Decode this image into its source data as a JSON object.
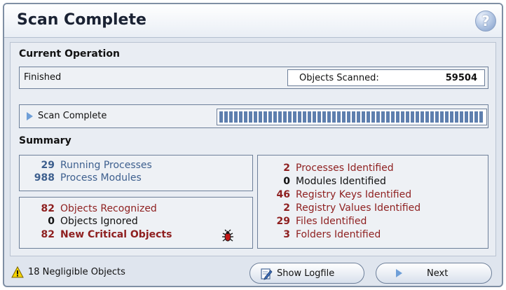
{
  "window": {
    "title": "Scan Complete",
    "help_label": "?"
  },
  "current_operation": {
    "heading": "Current Operation",
    "status": "Finished",
    "objects_scanned_label": "Objects Scanned:",
    "objects_scanned_value": "59504",
    "progress_label": "Scan Complete",
    "progress_fraction": 1.0
  },
  "summary": {
    "heading": "Summary",
    "processes": [
      {
        "count": "29",
        "label": "Running Processes"
      },
      {
        "count": "988",
        "label": "Process Modules"
      }
    ],
    "objects": [
      {
        "count": "82",
        "label": "Objects Recognized"
      },
      {
        "count": "0",
        "label": "Objects Ignored"
      },
      {
        "count": "82",
        "label": "New Critical Objects"
      }
    ],
    "identified": [
      {
        "count": "2",
        "label": "Processes Identified"
      },
      {
        "count": "0",
        "label": "Modules Identified"
      },
      {
        "count": "46",
        "label": "Registry Keys Identified"
      },
      {
        "count": "2",
        "label": "Registry Values Identified"
      },
      {
        "count": "29",
        "label": "Files Identified"
      },
      {
        "count": "3",
        "label": "Folders Identified"
      }
    ],
    "critical_icon": "bug-icon"
  },
  "footer": {
    "negligible_text": "18 Negligible Objects",
    "warning_icon": "warning-icon",
    "show_logfile_label": "Show Logfile",
    "next_label": "Next"
  },
  "colors": {
    "accent_blue": "#3d5f8e",
    "critical_red": "#8e1f1f"
  }
}
